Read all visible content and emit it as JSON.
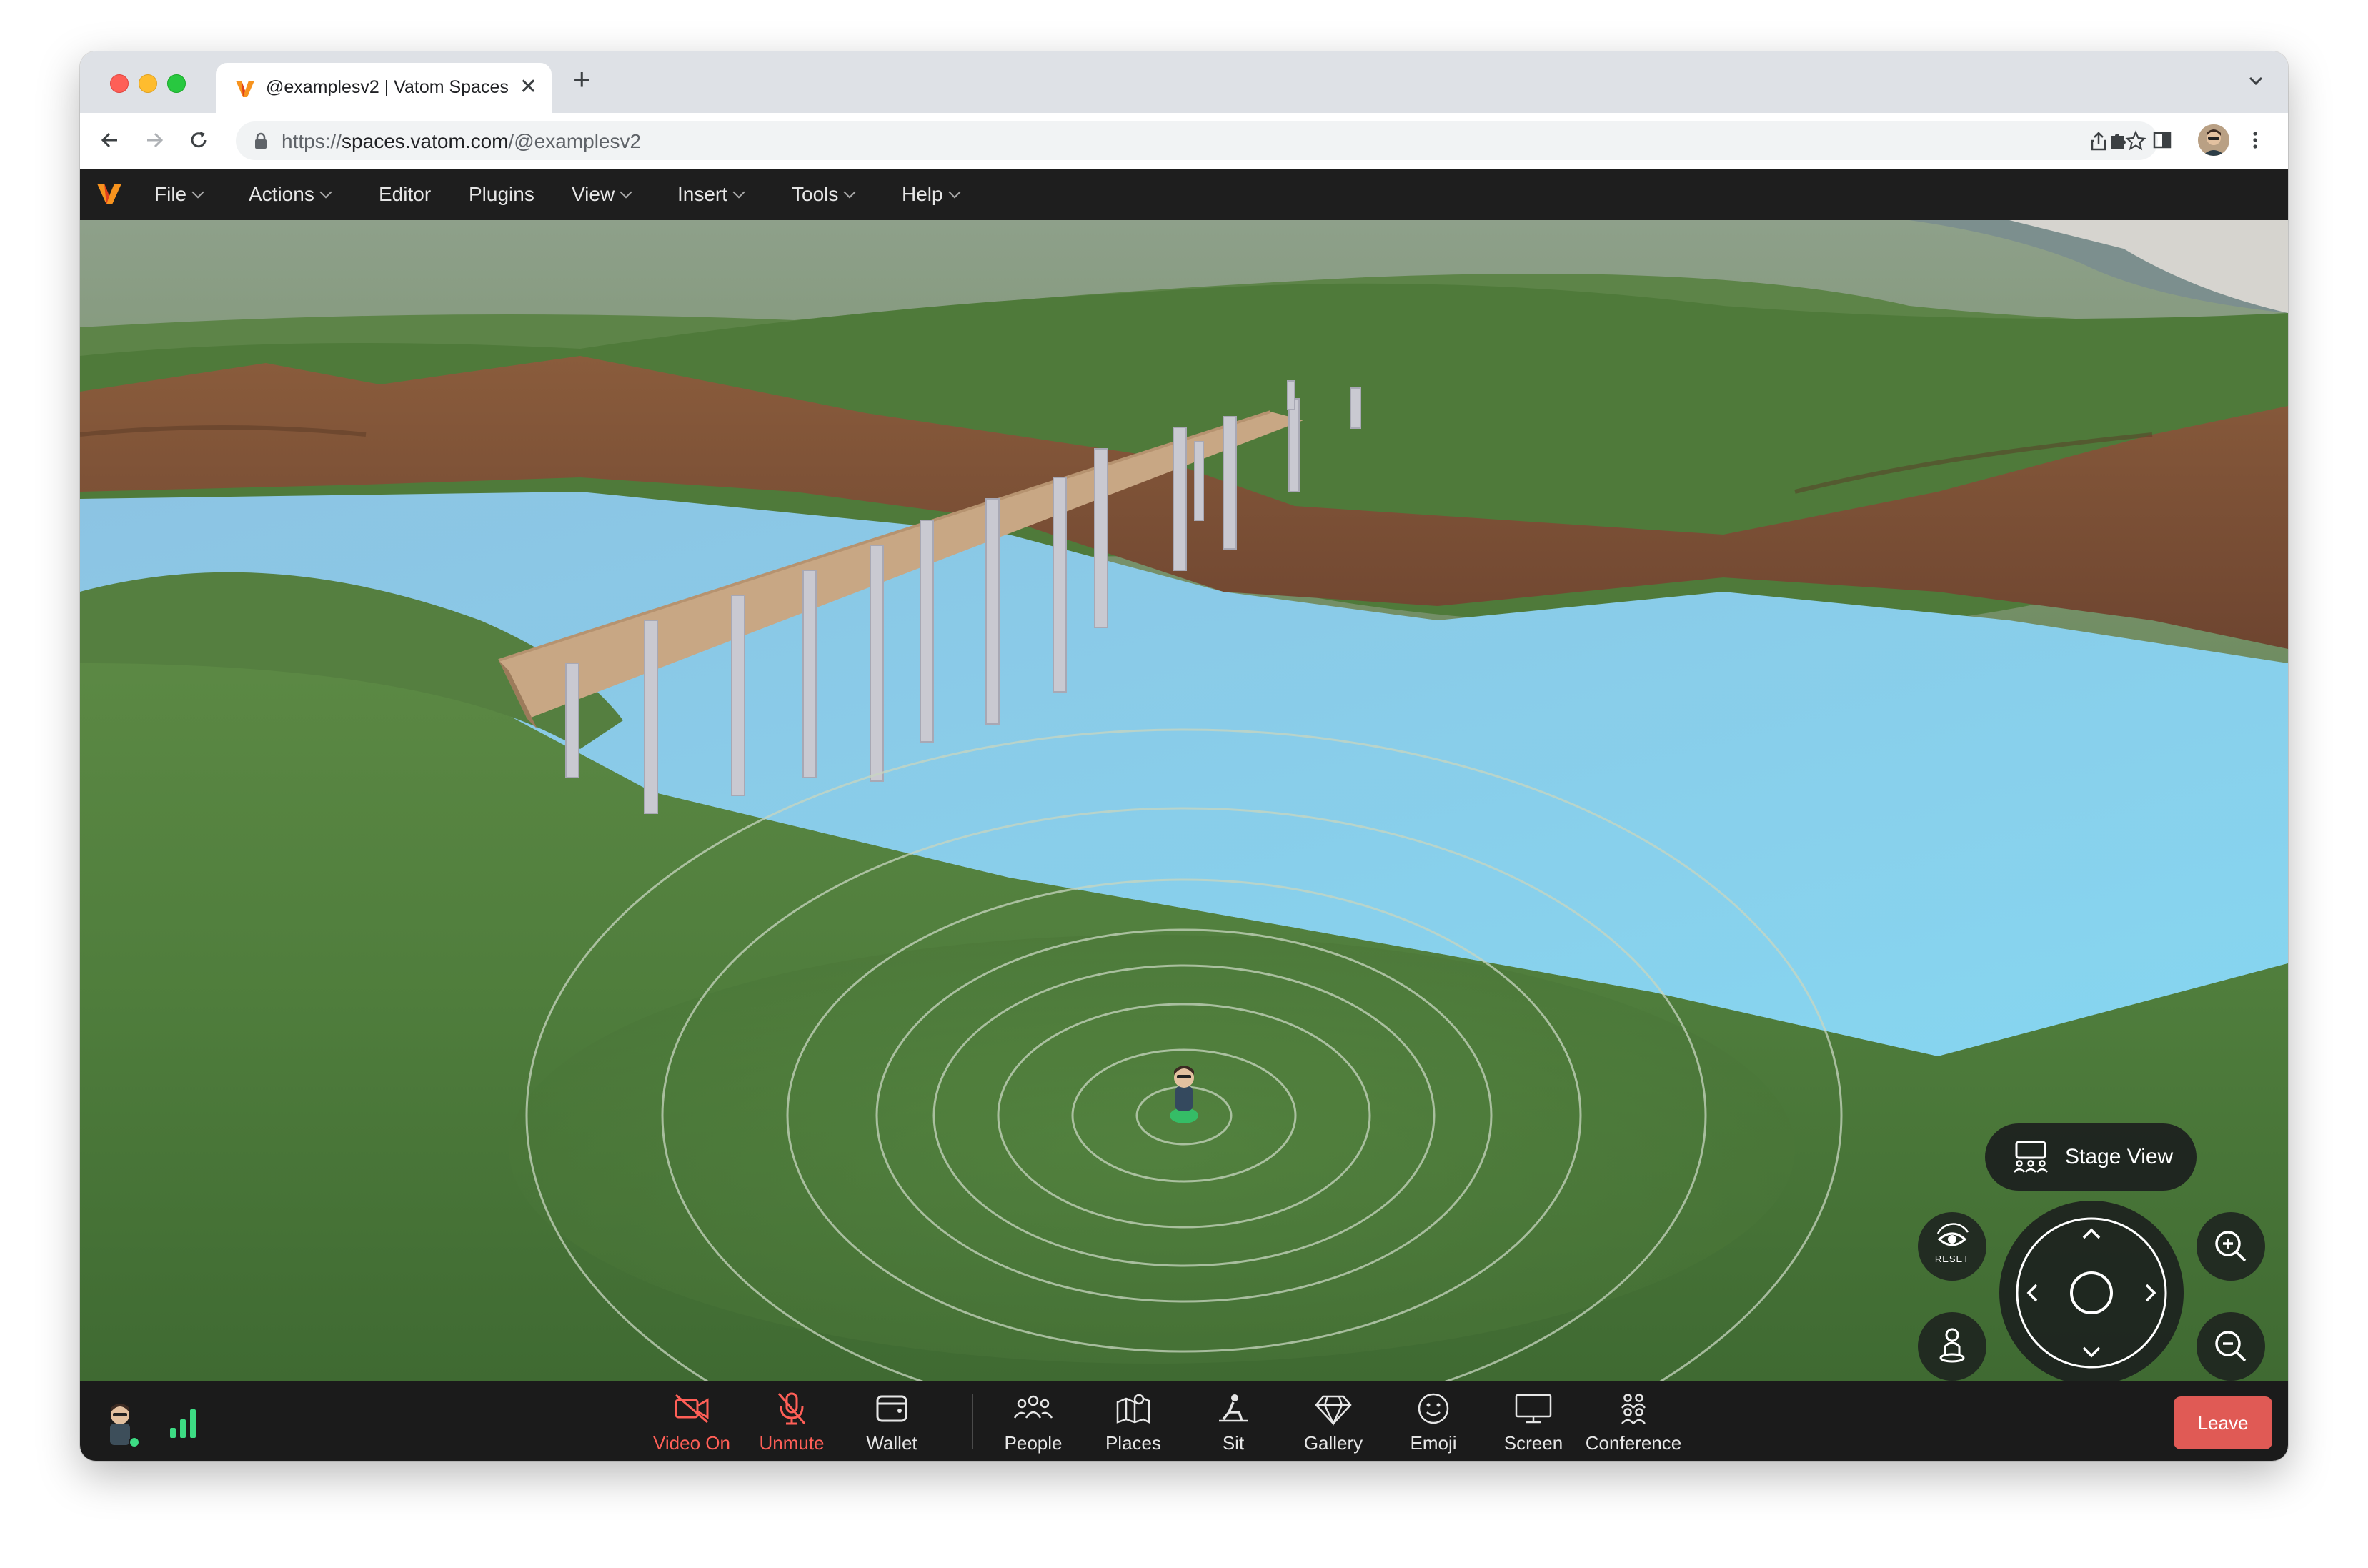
{
  "browser": {
    "tab_title": "@examplesv2 | Vatom Spaces",
    "new_tab": "+",
    "tab_close": "✕",
    "url_prefix": "https://",
    "url_host": "spaces.vatom.com",
    "url_path": "/@examplesv2"
  },
  "menubar": {
    "items": [
      {
        "label": "File",
        "has_dropdown": true
      },
      {
        "label": "Actions",
        "has_dropdown": true
      },
      {
        "label": "Editor",
        "has_dropdown": false
      },
      {
        "label": "Plugins",
        "has_dropdown": false
      },
      {
        "label": "View",
        "has_dropdown": true
      },
      {
        "label": "Insert",
        "has_dropdown": true
      },
      {
        "label": "Tools",
        "has_dropdown": true
      },
      {
        "label": "Help",
        "has_dropdown": true
      }
    ]
  },
  "viewport": {
    "stage_view_label": "Stage View",
    "reset_label": "RESET"
  },
  "toolbar": {
    "items": [
      {
        "label": "Video On",
        "icon": "video-off-icon",
        "active_alert": true
      },
      {
        "label": "Unmute",
        "icon": "mic-off-icon",
        "active_alert": true
      },
      {
        "label": "Wallet",
        "icon": "wallet-icon",
        "active_alert": false
      },
      {
        "label": "People",
        "icon": "people-icon",
        "active_alert": false
      },
      {
        "label": "Places",
        "icon": "map-icon",
        "active_alert": false
      },
      {
        "label": "Sit",
        "icon": "sit-icon",
        "active_alert": false
      },
      {
        "label": "Gallery",
        "icon": "gem-icon",
        "active_alert": false
      },
      {
        "label": "Emoji",
        "icon": "smile-icon",
        "active_alert": false
      },
      {
        "label": "Screen",
        "icon": "monitor-icon",
        "active_alert": false
      },
      {
        "label": "Conference",
        "icon": "conference-icon",
        "active_alert": false
      }
    ],
    "leave_label": "Leave"
  },
  "colors": {
    "accent_red": "#ff5f57",
    "leave_button": "#e05a55",
    "signal_green": "#3ddc84",
    "water": "#8fd0ea",
    "grass": "#5e8a45",
    "logo_orange": "#f7931e"
  }
}
